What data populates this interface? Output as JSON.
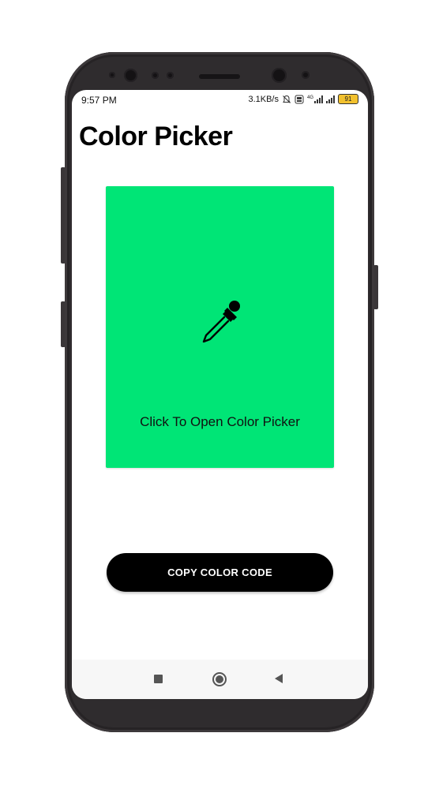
{
  "status_bar": {
    "time": "9:57 PM",
    "net_speed": "3.1KB/s",
    "battery": "91",
    "lte_label": "4G"
  },
  "app": {
    "title": "Color Picker",
    "panel_color": "#00e576",
    "panel_label": "Click To Open Color Picker",
    "copy_button_label": "COPY COLOR CODE"
  },
  "icons": {
    "picker": "eyedropper-icon",
    "nav_recent": "square-icon",
    "nav_home": "circle-icon",
    "nav_back": "triangle-back-icon"
  }
}
